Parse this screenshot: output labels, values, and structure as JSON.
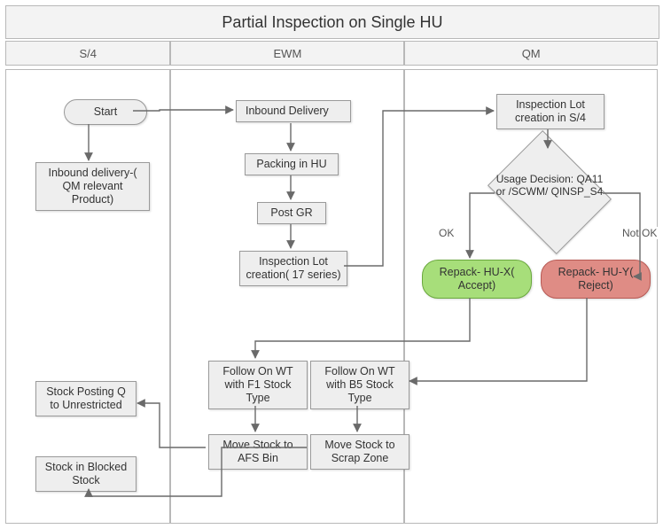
{
  "title": "Partial Inspection on Single HU",
  "lanes": {
    "s4": {
      "header": "S/4"
    },
    "ewm": {
      "header": "EWM"
    },
    "qm": {
      "header": "QM"
    }
  },
  "nodes": {
    "start": "Start",
    "inbound_s4": "Inbound delivery-( QM relevant Product)",
    "inbound_ewm": "Inbound Delivery",
    "packing": "Packing in HU",
    "postgr": "Post GR",
    "insplot_ewm": "Inspection Lot creation( 17 series)",
    "insplot_qm": "Inspection Lot creation in S/4",
    "ud": "Usage Decision: QA11 or /SCWM/ QINSP_S4",
    "ud_ok": "OK",
    "ud_notok": "Not OK",
    "repack_accept": "Repack- HU-X( Accept)",
    "repack_reject": "Repack- HU-Y( Reject)",
    "follow_f1": "Follow On WT with F1 Stock Type",
    "follow_b5": "Follow On WT with B5 Stock Type",
    "move_afs": "Move Stock to AFS Bin",
    "move_scrap": "Move Stock to Scrap Zone",
    "stock_unr": "Stock Posting Q to Unrestricted",
    "stock_blocked": "Stock in Blocked Stock"
  },
  "colors": {
    "accept": "#a7de7a",
    "reject": "#df8c85"
  },
  "chart_data": {
    "type": "table",
    "title": "Partial Inspection on Single HU",
    "swimlanes": [
      "S/4",
      "EWM",
      "QM"
    ],
    "nodes": [
      {
        "id": "start",
        "lane": "S/4",
        "label": "Start",
        "shape": "terminator"
      },
      {
        "id": "inbound_s4",
        "lane": "S/4",
        "label": "Inbound delivery-( QM relevant Product)",
        "shape": "process"
      },
      {
        "id": "inbound_ewm",
        "lane": "EWM",
        "label": "Inbound Delivery",
        "shape": "process"
      },
      {
        "id": "packing",
        "lane": "EWM",
        "label": "Packing in HU",
        "shape": "process"
      },
      {
        "id": "postgr",
        "lane": "EWM",
        "label": "Post GR",
        "shape": "process"
      },
      {
        "id": "insplot_ewm",
        "lane": "EWM",
        "label": "Inspection Lot creation( 17 series)",
        "shape": "process"
      },
      {
        "id": "insplot_qm",
        "lane": "QM",
        "label": "Inspection Lot creation in S/4",
        "shape": "process"
      },
      {
        "id": "ud",
        "lane": "QM",
        "label": "Usage Decision: QA11 or /SCWM/ QINSP_S4",
        "shape": "decision"
      },
      {
        "id": "repack_accept",
        "lane": "QM",
        "label": "Repack- HU-X( Accept)",
        "shape": "terminator",
        "color": "green"
      },
      {
        "id": "repack_reject",
        "lane": "QM",
        "label": "Repack- HU-Y( Reject)",
        "shape": "terminator",
        "color": "red"
      },
      {
        "id": "follow_f1",
        "lane": "EWM",
        "label": "Follow On WT with F1 Stock Type",
        "shape": "process"
      },
      {
        "id": "follow_b5",
        "lane": "EWM",
        "label": "Follow On WT with B5 Stock Type",
        "shape": "process"
      },
      {
        "id": "move_afs",
        "lane": "EWM",
        "label": "Move Stock to AFS Bin",
        "shape": "process"
      },
      {
        "id": "move_scrap",
        "lane": "EWM",
        "label": "Move Stock to Scrap Zone",
        "shape": "process"
      },
      {
        "id": "stock_unr",
        "lane": "S/4",
        "label": "Stock Posting Q to Unrestricted",
        "shape": "process"
      },
      {
        "id": "stock_blocked",
        "lane": "S/4",
        "label": "Stock in Blocked Stock",
        "shape": "process"
      }
    ],
    "edges": [
      {
        "from": "start",
        "to": "inbound_s4"
      },
      {
        "from": "start",
        "to": "inbound_ewm"
      },
      {
        "from": "inbound_ewm",
        "to": "packing"
      },
      {
        "from": "packing",
        "to": "postgr"
      },
      {
        "from": "postgr",
        "to": "insplot_ewm"
      },
      {
        "from": "insplot_ewm",
        "to": "insplot_qm"
      },
      {
        "from": "insplot_qm",
        "to": "ud"
      },
      {
        "from": "ud",
        "to": "repack_accept",
        "label": "OK"
      },
      {
        "from": "ud",
        "to": "repack_reject",
        "label": "Not OK"
      },
      {
        "from": "repack_accept",
        "to": "follow_f1"
      },
      {
        "from": "repack_reject",
        "to": "follow_b5"
      },
      {
        "from": "follow_f1",
        "to": "move_afs"
      },
      {
        "from": "follow_b5",
        "to": "move_scrap"
      },
      {
        "from": "move_afs",
        "to": "stock_unr"
      },
      {
        "from": "move_scrap",
        "to": "stock_blocked"
      }
    ]
  }
}
